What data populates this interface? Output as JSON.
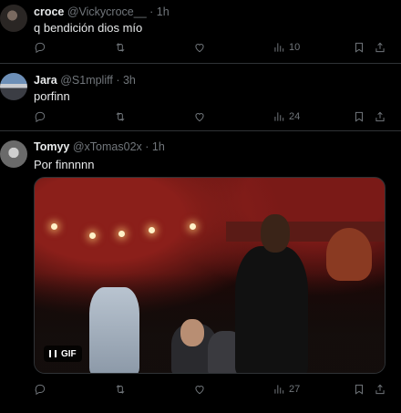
{
  "tweets": [
    {
      "name": "croce",
      "handle": "@Vickycroce__",
      "time": "1h",
      "text": "q bendición dios mío",
      "views": "10"
    },
    {
      "name": "Jara",
      "handle": "@S1mpliff",
      "time": "3h",
      "text": "porfinn",
      "views": "24"
    },
    {
      "name": "Tomyy",
      "handle": "@xTomas02x",
      "time": "1h",
      "text": "Por finnnnn",
      "views": "27",
      "media_badge": "GIF"
    }
  ],
  "separator": "·",
  "icons": [
    "reply-icon",
    "retweet-icon",
    "like-icon",
    "views-icon",
    "bookmark-icon",
    "share-icon",
    "pause-icon"
  ],
  "colors": {
    "background": "#000000",
    "text": "#e7e9ea",
    "muted": "#71767b",
    "border": "#2f3336"
  }
}
